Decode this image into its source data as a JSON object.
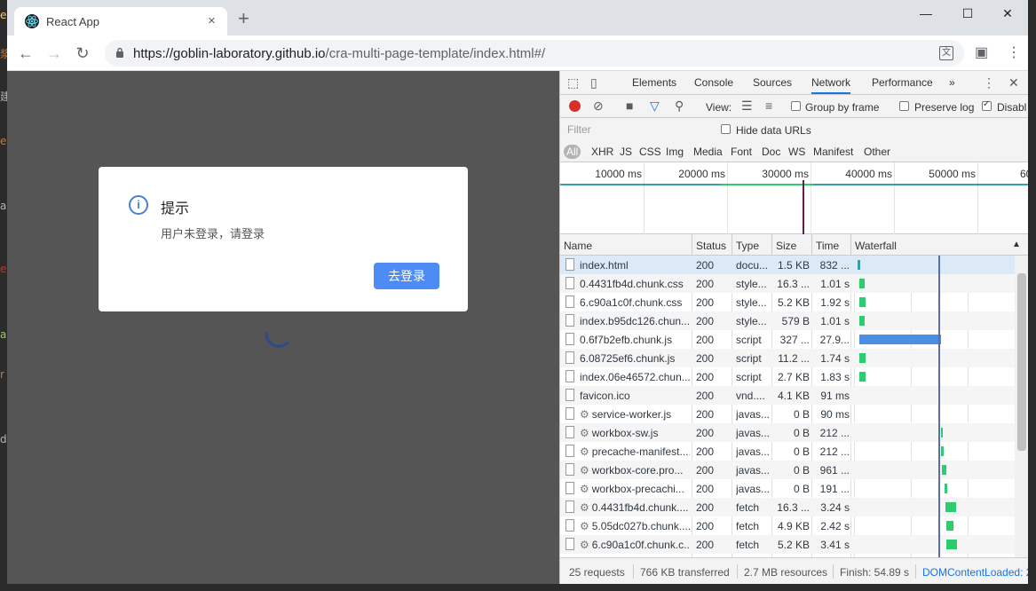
{
  "browser": {
    "tab_title": "React App",
    "tab_close": "×",
    "new_tab": "+",
    "url_host": "https://goblin-laboratory.github.io",
    "url_path": "/cra-multi-page-template/index.html#/",
    "minimize": "—",
    "maximize": "☐",
    "close": "✕"
  },
  "dialog": {
    "title": "提示",
    "message": "用户未登录，请登录",
    "button": "去登录"
  },
  "devtools": {
    "tabs": [
      "Elements",
      "Console",
      "Sources",
      "Network",
      "Performance"
    ],
    "active_tab": "Network",
    "more": "»",
    "toolbar": {
      "view_label": "View:",
      "group_by_frame": "Group by frame",
      "preserve_log": "Preserve log",
      "disable_cache": "Disabl"
    },
    "filter_placeholder": "Filter",
    "hide_data_urls": "Hide data URLs",
    "types": [
      "All",
      "XHR",
      "JS",
      "CSS",
      "Img",
      "Media",
      "Font",
      "Doc",
      "WS",
      "Manifest",
      "Other"
    ],
    "overview_ticks": [
      "10000 ms",
      "20000 ms",
      "30000 ms",
      "40000 ms",
      "50000 ms",
      "60"
    ],
    "columns": [
      "Name",
      "Status",
      "Type",
      "Size",
      "Time",
      "Waterfall"
    ],
    "rows": [
      {
        "name": "index.html",
        "status": "200",
        "type": "docu...",
        "size": "1.5 KB",
        "time": "832 ...",
        "sw": false
      },
      {
        "name": "0.4431fb4d.chunk.css",
        "status": "200",
        "type": "style...",
        "size": "16.3 ...",
        "time": "1.01 s",
        "sw": false
      },
      {
        "name": "6.c90a1c0f.chunk.css",
        "status": "200",
        "type": "style...",
        "size": "5.2 KB",
        "time": "1.92 s",
        "sw": false
      },
      {
        "name": "index.b95dc126.chun...",
        "status": "200",
        "type": "style...",
        "size": "579 B",
        "time": "1.01 s",
        "sw": false
      },
      {
        "name": "0.6f7b2efb.chunk.js",
        "status": "200",
        "type": "script",
        "size": "327 ...",
        "time": "27.9...",
        "sw": false
      },
      {
        "name": "6.08725ef6.chunk.js",
        "status": "200",
        "type": "script",
        "size": "11.2 ...",
        "time": "1.74 s",
        "sw": false
      },
      {
        "name": "index.06e46572.chun...",
        "status": "200",
        "type": "script",
        "size": "2.7 KB",
        "time": "1.83 s",
        "sw": false
      },
      {
        "name": "favicon.ico",
        "status": "200",
        "type": "vnd....",
        "size": "4.1 KB",
        "time": "91 ms",
        "sw": false
      },
      {
        "name": "service-worker.js",
        "status": "200",
        "type": "javas...",
        "size": "0 B",
        "time": "90 ms",
        "sw": true
      },
      {
        "name": "workbox-sw.js",
        "status": "200",
        "type": "javas...",
        "size": "0 B",
        "time": "212 ...",
        "sw": true
      },
      {
        "name": "precache-manifest....",
        "status": "200",
        "type": "javas...",
        "size": "0 B",
        "time": "212 ...",
        "sw": true
      },
      {
        "name": "workbox-core.pro...",
        "status": "200",
        "type": "javas...",
        "size": "0 B",
        "time": "961 ...",
        "sw": true
      },
      {
        "name": "workbox-precachi...",
        "status": "200",
        "type": "javas...",
        "size": "0 B",
        "time": "191 ...",
        "sw": true
      },
      {
        "name": "0.4431fb4d.chunk....",
        "status": "200",
        "type": "fetch",
        "size": "16.3 ...",
        "time": "3.24 s",
        "sw": true
      },
      {
        "name": "5.05dc027b.chunk....",
        "status": "200",
        "type": "fetch",
        "size": "4.9 KB",
        "time": "2.42 s",
        "sw": true
      },
      {
        "name": "6.c90a1c0f.chunk.c...",
        "status": "200",
        "type": "fetch",
        "size": "5.2 KB",
        "time": "3.41 s",
        "sw": true
      }
    ],
    "status_bar": {
      "requests": "25 requests",
      "transferred": "766 KB transferred",
      "resources": "2.7 MB resources",
      "finish": "Finish: 54.89 s",
      "dcl": "DOMContentLoaded: 2"
    }
  },
  "colors": {
    "primary_button": "#4d8cf5",
    "record": "#d93025",
    "active_tab_underline": "#1a73e8",
    "waterfall_green": "#2ecc71",
    "waterfall_blue": "#4a90e2"
  }
}
